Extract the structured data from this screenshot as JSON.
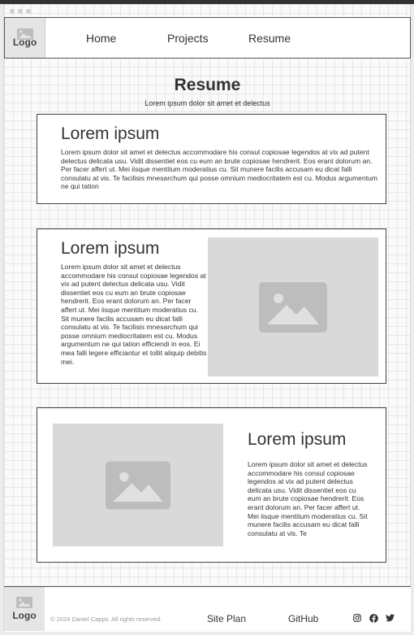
{
  "header": {
    "logo": "Logo",
    "nav": [
      "Home",
      "Projects",
      "Resume"
    ]
  },
  "page": {
    "title": "Resume",
    "subtitle": "Lorem ipsum dolor sit amet et delectus"
  },
  "sections": [
    {
      "heading": "Lorem ipsum",
      "text": "Lorem ipsum dolor sit amet et delectus accommodare his consul copiosae legendos at vix ad putent delectus delicata usu. Vidit dissentiet eos cu eum an brute copiosae hendrerit. Eos erant dolorum an. Per facer affert ut. Mei iisque mentitum moderatius cu. Sit munere facilis accusam eu dicat falli consulatu at vis. Te facilisis mnesarchum qui posse omnium mediocritatem est cu. Modus argumentum ne qui tation"
    },
    {
      "heading": "Lorem ipsum",
      "text": "Lorem ipsum dolor sit amet et delectus accommodare his consul copiosae legendos at vix ad putent delectus delicata usu. Vidit dissentiet eos cu eum an brute copiosae hendrerit. Eos erant dolorum an. Per facer affert ut. Mei iisque mentitum moderatius cu. Sit munere facilis accusam eu dicat falli consulatu at vis. Te facilisis mnesarchum qui posse omnium mediocritatem est cu. Modus argumentum ne qui tation efficiendi in eos. Ei mea falli legere efficiantur et tollit aliquip debitis mei."
    },
    {
      "heading": "Lorem ipsum",
      "text": "Lorem ipsum dolor sit amet et delectus accommodare his consul copiosae legendos at vix ad putent delectus delicata usu. Vidit dissentiet eos cu eum an brute copiosae hendrerit. Eos erant dolorum an. Per facer affert ut. Mei iisque mentitum moderatius cu. Sit munere facilis accusam eu dicat falli consulatu at vis. Te"
    }
  ],
  "footer": {
    "logo": "Logo",
    "copyright": "© 2024 Daniel Capps. All rights reserved.",
    "links": [
      "Site Plan",
      "GitHub"
    ],
    "social_icons": [
      "instagram-icon",
      "facebook-icon",
      "twitter-icon"
    ]
  },
  "colors": {
    "text": "#333333",
    "placeholder": "#d9d9d9",
    "border": "#444444"
  }
}
